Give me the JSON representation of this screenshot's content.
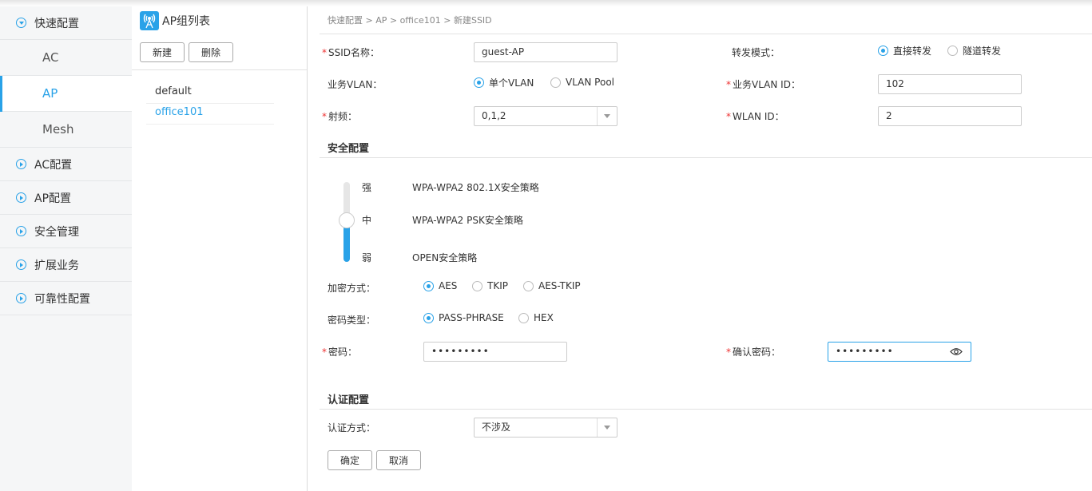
{
  "nav": {
    "groups": [
      {
        "label": "快速配置",
        "expanded": true,
        "children": [
          "AC",
          "AP",
          "Mesh"
        ],
        "active_child": "AP"
      },
      {
        "label": "AC配置"
      },
      {
        "label": "AP配置"
      },
      {
        "label": "安全管理"
      },
      {
        "label": "扩展业务"
      },
      {
        "label": "可靠性配置"
      }
    ]
  },
  "group_panel": {
    "title": "AP组列表",
    "new_label": "新建",
    "delete_label": "删除",
    "items": [
      "default",
      "office101"
    ],
    "selected": "office101"
  },
  "breadcrumb": "快速配置 > AP > office101 > 新建SSID",
  "form": {
    "ssid_label": "SSID名称：",
    "ssid_value": "guest-AP",
    "forward_label": "转发模式：",
    "forward_options": [
      "直接转发",
      "隧道转发"
    ],
    "forward_selected": "直接转发",
    "vlan_label": "业务VLAN：",
    "vlan_options": [
      "单个VLAN",
      "VLAN Pool"
    ],
    "vlan_selected": "单个VLAN",
    "vlan_id_label": "业务VLAN ID：",
    "vlan_id_value": "102",
    "radio_label": "射频：",
    "radio_value": "0,1,2",
    "wlan_id_label": "WLAN ID：",
    "wlan_id_value": "2"
  },
  "security": {
    "title": "安全配置",
    "levels": [
      {
        "level": "强",
        "policy": "WPA-WPA2 802.1X安全策略"
      },
      {
        "level": "中",
        "policy": "WPA-WPA2 PSK安全策略"
      },
      {
        "level": "弱",
        "policy": "OPEN安全策略"
      }
    ],
    "selected_level": "中",
    "encrypt_label": "加密方式：",
    "encrypt_options": [
      "AES",
      "TKIP",
      "AES-TKIP"
    ],
    "encrypt_selected": "AES",
    "pwtype_label": "密码类型：",
    "pwtype_options": [
      "PASS-PHRASE",
      "HEX"
    ],
    "pwtype_selected": "PASS-PHRASE",
    "password_label": "密码：",
    "password_value": "•••••••••",
    "confirm_label": "确认密码：",
    "confirm_value": "•••••••••"
  },
  "auth": {
    "title": "认证配置",
    "method_label": "认证方式：",
    "method_value": "不涉及"
  },
  "actions": {
    "ok_label": "确定",
    "cancel_label": "取消"
  },
  "colors": {
    "accent": "#29a2e8",
    "required": "#e33333"
  }
}
